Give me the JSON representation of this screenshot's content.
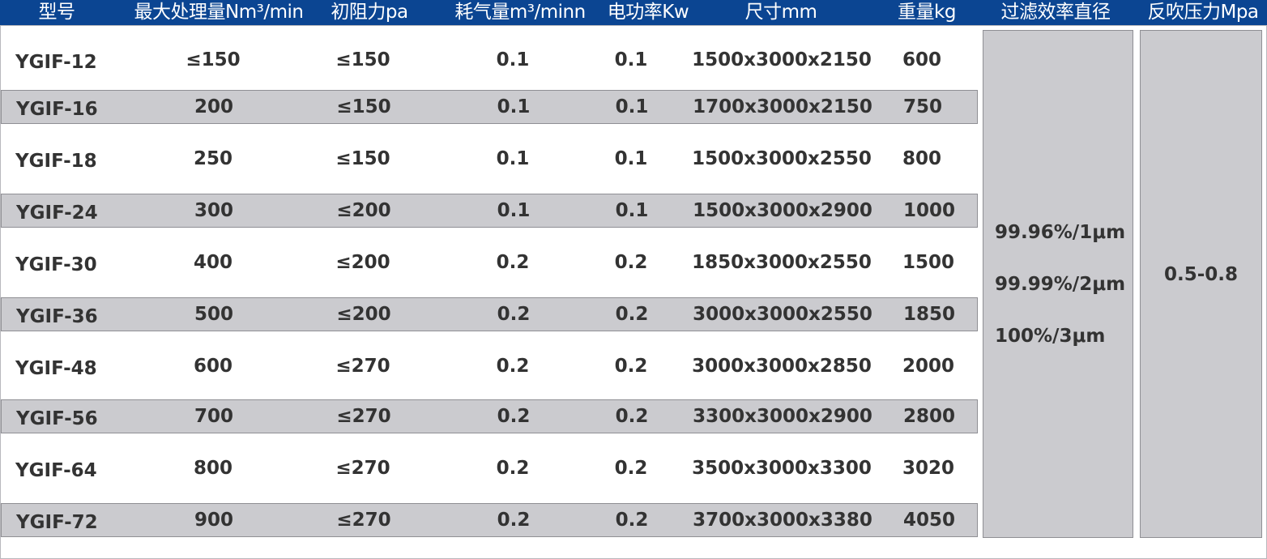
{
  "headers": {
    "model": "型号",
    "capacity": "最大处理量Nm³/min",
    "resistance": "初阻力pa",
    "air": "耗气量m³/minn",
    "power": "电功率Kw",
    "size": "尺寸mm",
    "weight": "重量kg",
    "efficiency": "过滤效率直径",
    "pressure": "反吹压力Mpa"
  },
  "rows": [
    {
      "model": "YGIF-12",
      "capacity": "≤150",
      "resistance": "≤150",
      "air": "0.1",
      "power": "0.1",
      "size": "1500x3000x2150",
      "weight": "600"
    },
    {
      "model": "YGIF-16",
      "capacity": "200",
      "resistance": "≤150",
      "air": "0.1",
      "power": "0.1",
      "size": "1700x3000x2150",
      "weight": "750"
    },
    {
      "model": "YGIF-18",
      "capacity": "250",
      "resistance": "≤150",
      "air": "0.1",
      "power": "0.1",
      "size": "1500x3000x2550",
      "weight": "800"
    },
    {
      "model": "YGIF-24",
      "capacity": "300",
      "resistance": "≤200",
      "air": "0.1",
      "power": "0.1",
      "size": "1500x3000x2900",
      "weight": "1000"
    },
    {
      "model": "YGIF-30",
      "capacity": "400",
      "resistance": "≤200",
      "air": "0.2",
      "power": "0.2",
      "size": "1850x3000x2550",
      "weight": "1500"
    },
    {
      "model": "YGIF-36",
      "capacity": "500",
      "resistance": "≤200",
      "air": "0.2",
      "power": "0.2",
      "size": "3000x3000x2550",
      "weight": "1850"
    },
    {
      "model": "YGIF-48",
      "capacity": "600",
      "resistance": "≤270",
      "air": "0.2",
      "power": "0.2",
      "size": "3000x3000x2850",
      "weight": "2000"
    },
    {
      "model": "YGIF-56",
      "capacity": "700",
      "resistance": "≤270",
      "air": "0.2",
      "power": "0.2",
      "size": "3300x3000x2900",
      "weight": "2800"
    },
    {
      "model": "YGIF-64",
      "capacity": "800",
      "resistance": "≤270",
      "air": "0.2",
      "power": "0.2",
      "size": "3500x3000x3300",
      "weight": "3020"
    },
    {
      "model": "YGIF-72",
      "capacity": "900",
      "resistance": "≤270",
      "air": "0.2",
      "power": "0.2",
      "size": "3700x3000x3380",
      "weight": "4050"
    }
  ],
  "efficiency_values": [
    "99.96%/1μm",
    "99.99%/2μm",
    "100%/3μm"
  ],
  "pressure_value": "0.5-0.8",
  "colors": {
    "header_bg": "#0b4592",
    "header_text": "#ffffff",
    "shaded_row": "#cbcbcf",
    "text": "#333333"
  }
}
